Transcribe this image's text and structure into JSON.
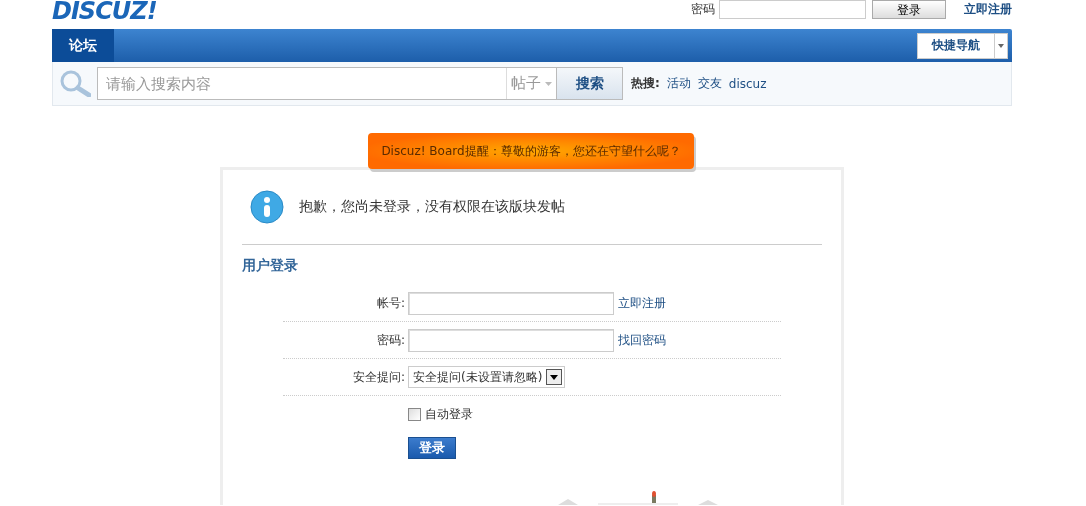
{
  "logo": {
    "text": "DISCUZ!"
  },
  "top_login": {
    "password_label": "密码",
    "login_button": "登录",
    "register_link": "立即注册"
  },
  "nav": {
    "tabs": [
      {
        "label": "论坛",
        "selected": true
      }
    ],
    "quick_nav": "快捷导航"
  },
  "search": {
    "placeholder": "请输入搜索内容",
    "type": "帖子",
    "button": "搜索",
    "hot_label": "热搜:",
    "hot_links": [
      "活动",
      "交友",
      "discuz"
    ]
  },
  "notice": "Discuz! Board提醒：尊敬的游客，您还在守望什么呢？",
  "message": "抱歉，您尚未登录，没有权限在该版块发帖",
  "login": {
    "title": "用户登录",
    "fields": [
      {
        "kind": "text",
        "label": "帐号:",
        "link": "立即注册"
      },
      {
        "kind": "password",
        "label": "密码:",
        "link": "找回密码"
      },
      {
        "kind": "select",
        "label": "安全提问:",
        "value": "安全提问(未设置请忽略)"
      }
    ],
    "remember": {
      "label": "自动登录",
      "checked": false
    },
    "submit": "登录"
  }
}
